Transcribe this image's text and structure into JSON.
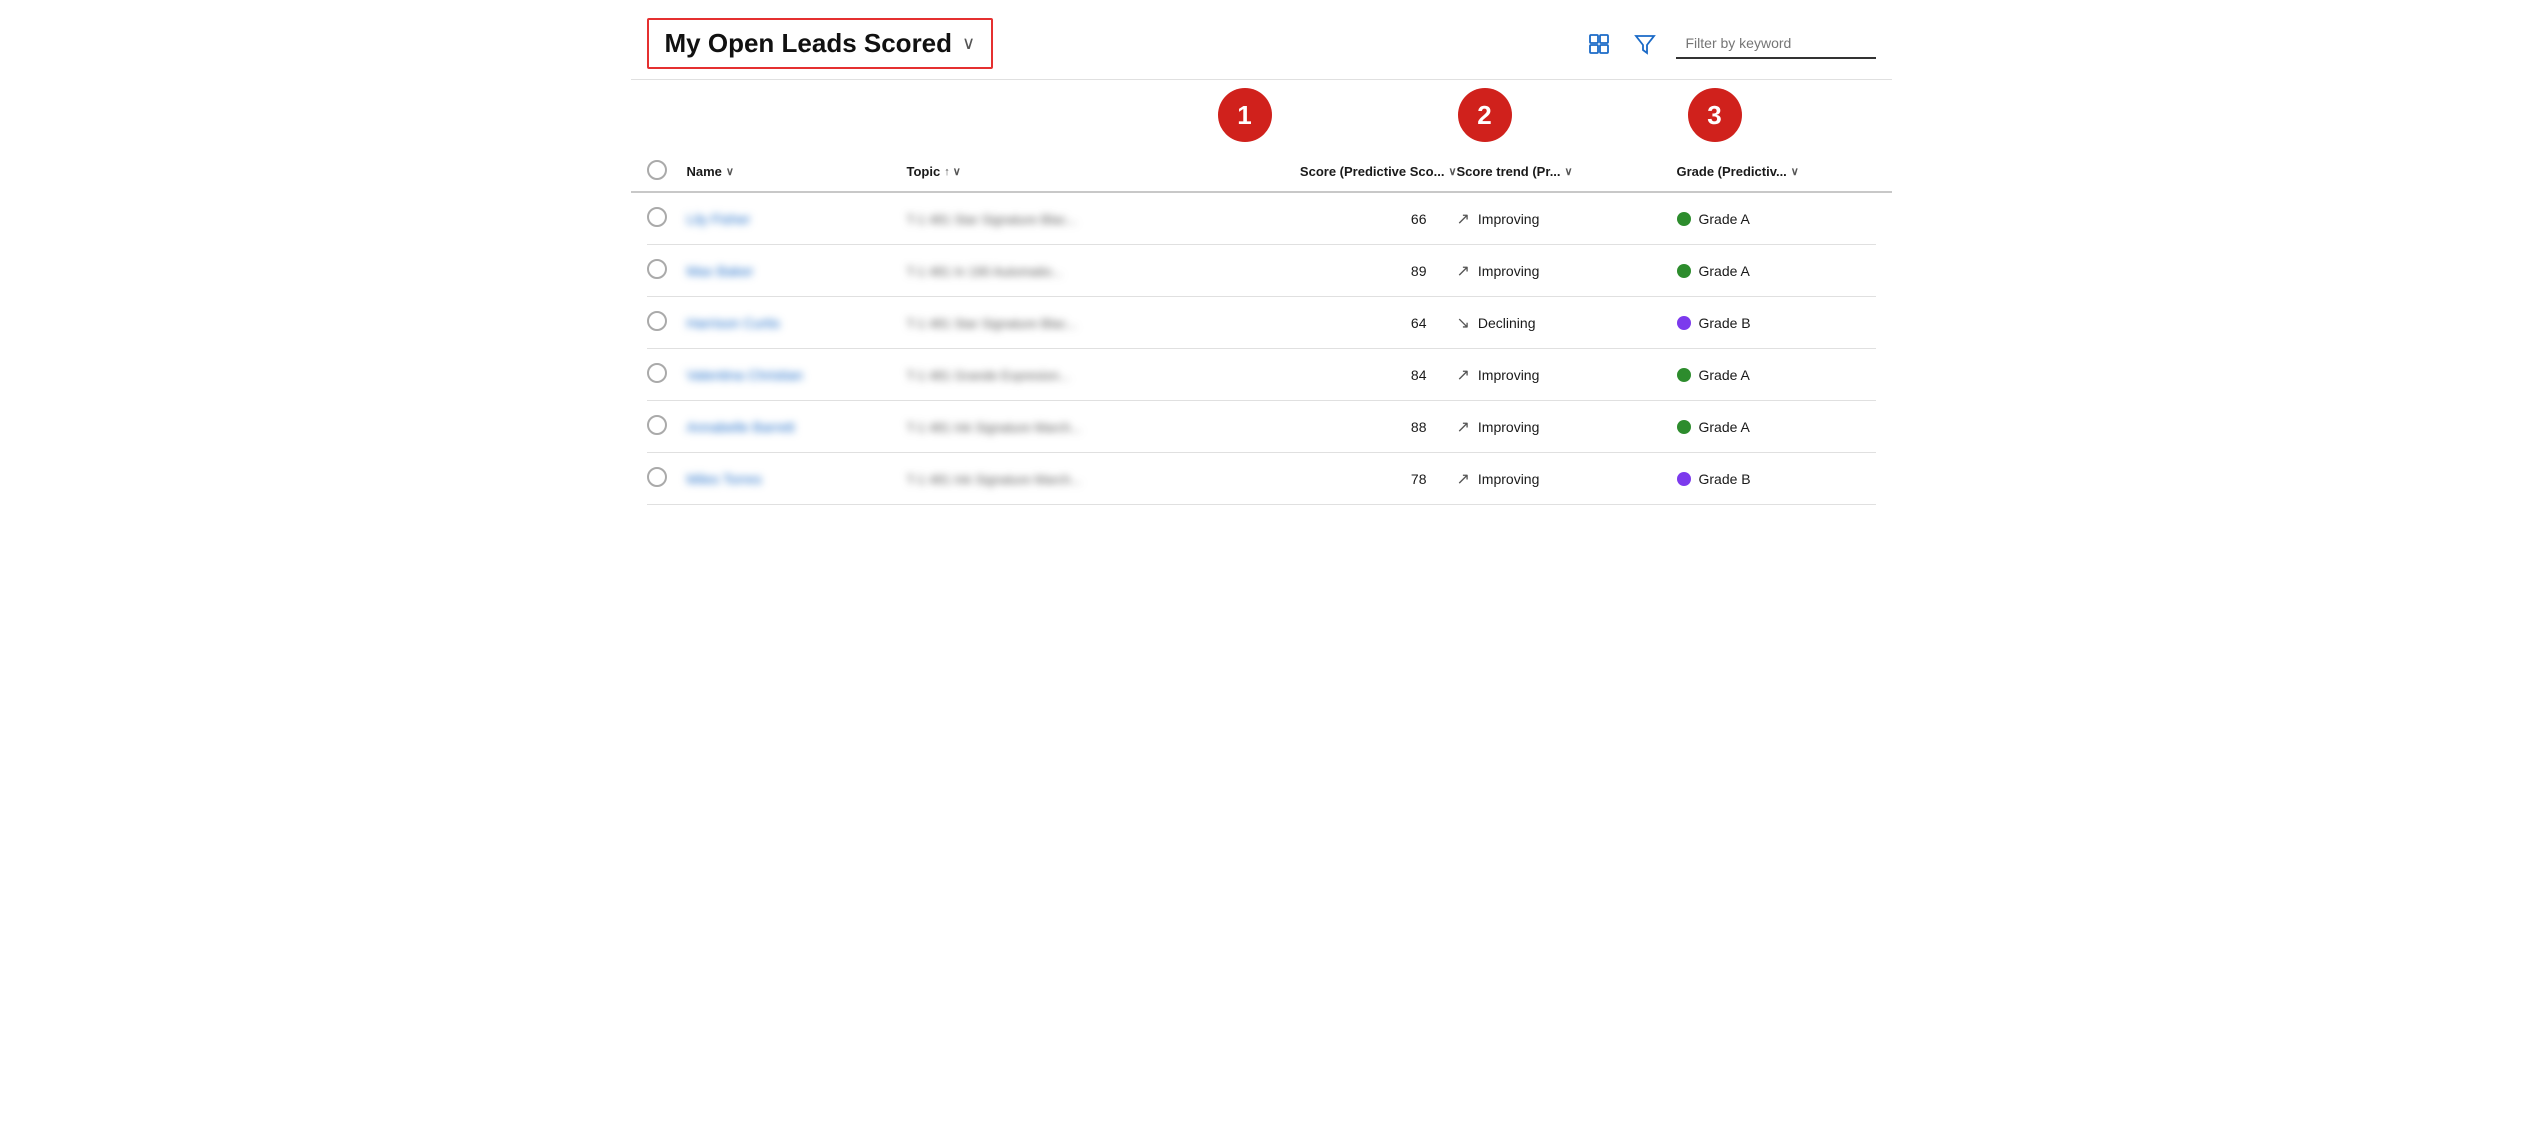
{
  "header": {
    "title": "My Open Leads Scored",
    "chevron": "∨",
    "filter_placeholder": "Filter by keyword"
  },
  "annotations": [
    {
      "id": "1",
      "label": "1"
    },
    {
      "id": "2",
      "label": "2"
    },
    {
      "id": "3",
      "label": "3"
    }
  ],
  "columns": {
    "check": "",
    "name": "Name",
    "name_sort": "∨",
    "topic": "Topic",
    "topic_sort": "↑ ∨",
    "score": "Score (Predictive Sco...",
    "score_sort": "∨",
    "trend": "Score trend (Pr...",
    "trend_sort": "∨",
    "grade": "Grade (Predictiv...",
    "grade_sort": "∨"
  },
  "rows": [
    {
      "name": "Lily Fisher",
      "topic": "T-1 481 Star Signature Blac...",
      "score": "66",
      "trend_arrow": "↗",
      "trend_label": "Improving",
      "grade_color": "green",
      "grade_label": "Grade A"
    },
    {
      "name": "Max Baker",
      "topic": "T-1 481 In 190 Automatio...",
      "score": "89",
      "trend_arrow": "↗",
      "trend_label": "Improving",
      "grade_color": "green",
      "grade_label": "Grade A"
    },
    {
      "name": "Harrison Curtis",
      "topic": "T-1 481 Star Signature Blac...",
      "score": "64",
      "trend_arrow": "↘",
      "trend_label": "Declining",
      "grade_color": "purple",
      "grade_label": "Grade B"
    },
    {
      "name": "Valentina Christian",
      "topic": "T-1 481 Grande Expresion...",
      "score": "84",
      "trend_arrow": "↗",
      "trend_label": "Improving",
      "grade_color": "green",
      "grade_label": "Grade A"
    },
    {
      "name": "Annabelle Barrett",
      "topic": "T-1 481 Ink Signature March...",
      "score": "88",
      "trend_arrow": "↗",
      "trend_label": "Improving",
      "grade_color": "green",
      "grade_label": "Grade A"
    },
    {
      "name": "Miles Torres",
      "topic": "T-1 481 Ink Signature March...",
      "score": "78",
      "trend_arrow": "↗",
      "trend_label": "Improving",
      "grade_color": "purple",
      "grade_label": "Grade B"
    }
  ]
}
